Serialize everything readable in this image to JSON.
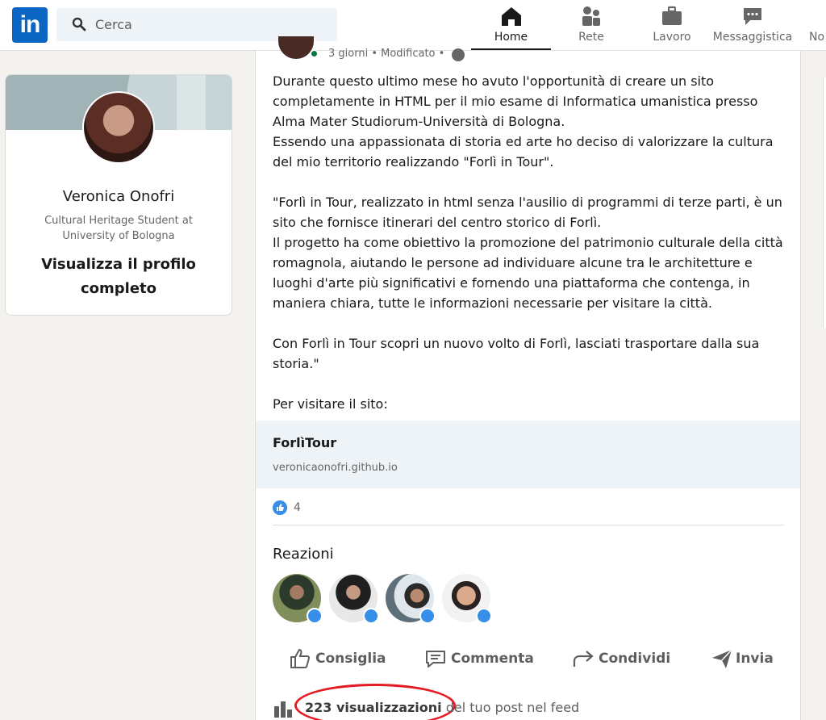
{
  "nav": {
    "logo": "in",
    "search_placeholder": "Cerca",
    "items": [
      {
        "label": "Home",
        "icon": "home-icon",
        "active": true
      },
      {
        "label": "Rete",
        "icon": "network-icon"
      },
      {
        "label": "Lavoro",
        "icon": "briefcase-icon"
      },
      {
        "label": "Messaggistica",
        "icon": "messaging-icon"
      },
      {
        "label": "No",
        "icon": "notifications-icon"
      }
    ]
  },
  "profile": {
    "name": "Veronica Onofri",
    "headline": "Cultural Heritage Student at University of Bologna",
    "view_profile": "Visualizza il profilo completo"
  },
  "post": {
    "meta": "3 giorni • Modificato •",
    "paragraphs": [
      "Durante questo ultimo mese ho avuto l'opportunità di creare un sito completamente in HTML per il mio esame di Informatica umanistica presso  Alma Mater Studiorum-Università di Bologna.\nEssendo una appassionata di storia ed arte ho deciso di valorizzare la cultura del mio territorio realizzando \"Forlì in Tour\".",
      "\"Forlì in Tour, realizzato in html senza l'ausilio di programmi di terze parti, è un sito che fornisce itinerari del centro storico di Forlì.\nIl progetto ha come obiettivo la promozione del patrimonio culturale della città romagnola, aiutando le persone ad individuare alcune tra le architetture e luoghi d'arte più significativi e fornendo una piattaforma che contenga, in maniera chiara, tutte le informazioni necessarie per visitare la città.",
      "Con Forlì in Tour scopri un nuovo volto di Forlì, lasciati trasportare dalla sua storia.\"",
      "Per visitare il sito:"
    ],
    "link_title": "ForlìTour",
    "link_domain": "veronicaonofri.github.io",
    "like_count": "4",
    "reactions_title": "Reazioni",
    "actions": {
      "like": "Consiglia",
      "comment": "Commenta",
      "share": "Condividi",
      "send": "Invia"
    },
    "views_strong": "223 visualizzazioni",
    "views_rest": " del tuo post nel feed"
  },
  "colors": {
    "brand": "#0a66c2",
    "like_blue": "#378fe9",
    "online_green": "#057642",
    "annotation_red": "#e31b23"
  }
}
